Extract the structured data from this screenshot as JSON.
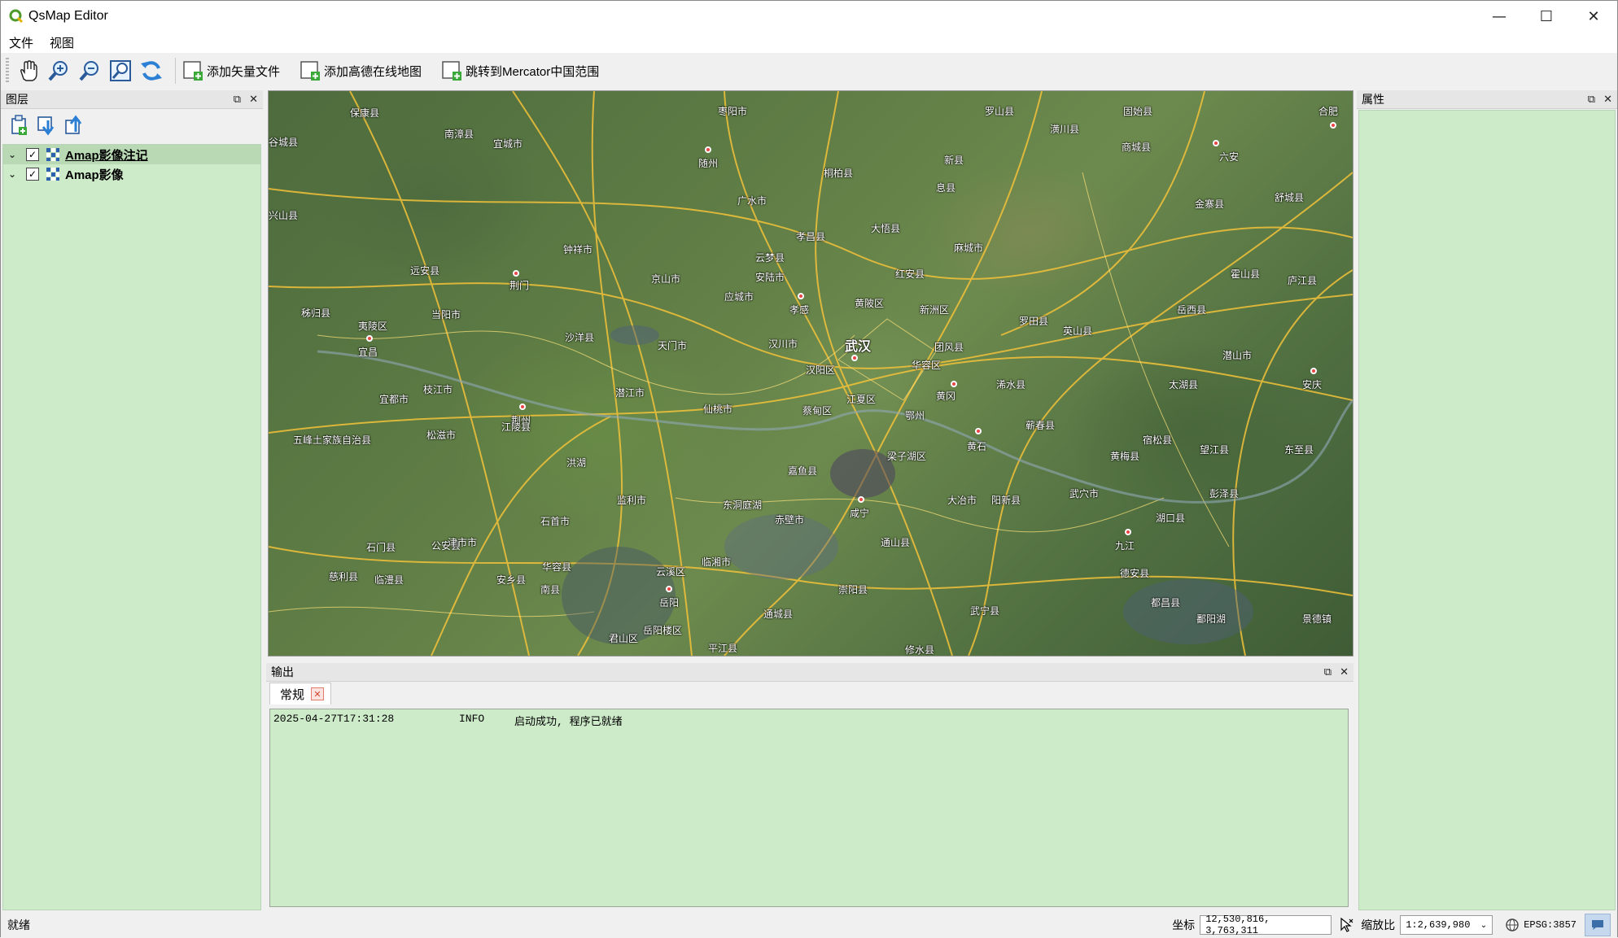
{
  "window": {
    "title": "QsMap Editor",
    "minimize": "—",
    "maximize": "☐",
    "close": "✕"
  },
  "menu": {
    "items": [
      "文件",
      "视图"
    ]
  },
  "toolbar": {
    "tools": [
      "pan-icon",
      "zoom-in-icon",
      "zoom-out-icon",
      "zoom-full-icon",
      "refresh-icon"
    ],
    "add_vector_label": "添加矢量文件",
    "add_amap_label": "添加高德在线地图",
    "jump_mercator_label": "跳转到Mercator中国范围"
  },
  "layers_panel": {
    "title": "图层",
    "layers": [
      {
        "name": "Amap影像注记",
        "checked": true,
        "selected": true
      },
      {
        "name": "Amap影像",
        "checked": true,
        "selected": false
      }
    ]
  },
  "attributes_panel": {
    "title": "属性"
  },
  "output_panel": {
    "title": "输出",
    "tab_label": "常规",
    "log": [
      {
        "time": "2025-04-27T17:31:28",
        "level": "INFO",
        "message": "启动成功, 程序已就绪"
      }
    ]
  },
  "map": {
    "labels": {
      "wuhan": "武汉",
      "xiaogan": "孝感",
      "huanggang": "黄冈",
      "huangshi": "黄石",
      "jingzhou": "荆州",
      "jingmen": "荆门",
      "yichang": "宜昌",
      "xianning": "咸宁",
      "yueyang": "岳阳",
      "jiujiang": "九江",
      "anqing": "安庆",
      "luan": "六安",
      "hefei": "合肥",
      "suizhou": "随州",
      "xinxian": "新县",
      "macheng": "麻城市",
      "tianmen": "天门市",
      "qianjiang": "潜江市",
      "xiantao": "仙桃市",
      "honghu": "洪湖",
      "jianli": "监利市",
      "shishou": "石首市",
      "gongan": "公安县",
      "songzi": "松滋市",
      "zhijiang": "枝江市",
      "dangyang": "当阳市",
      "yidu": "宜都市",
      "wufeng": "五峰土家族自治县",
      "yuanan": "远安县",
      "nanzhang": "南漳县",
      "baokang": "保康县",
      "xiangyang": "襄阳",
      "yicheng": "宜城市",
      "zhongxiang": "钟祥市",
      "shayang": "沙洋县",
      "jingshan": "京山市",
      "yingcheng": "应城市",
      "anlu": "安陆市",
      "guangshui": "广水市",
      "dawu": "大悟县",
      "hongan": "红安县",
      "huangpi": "黄陂区",
      "xinzhou": "新洲区",
      "tuanfeng": "团风县",
      "luotian": "罗田县",
      "yingshan": "英山县",
      "xishui": "浠水县",
      "qichun": "蕲春县",
      "wuxue": "武穴市",
      "huangmei": "黄梅县",
      "yangxin": "阳新县",
      "daye": "大冶市",
      "ezhou": "鄂州",
      "jiayu": "嘉鱼县",
      "chibi": "赤壁市",
      "chongyang": "崇阳县",
      "tongcheng": "通城县",
      "tongshan": "通山县",
      "linxiang": "临湘市",
      "huarong": "华容县",
      "nanxian": "南县",
      "anxiang": "安乡县",
      "linli": "临澧县",
      "cili": "慈利县",
      "shimen": "石门县",
      "jinzhou": "津市市",
      "hanyang": "汉阳区",
      "caidian": "蔡甸区",
      "jiangxia": "江夏区",
      "hanchuan": "汉川市",
      "huarongqu": "华容区",
      "xiaochang": "孝昌县",
      "yunmeng": "云梦县",
      "taihu": "太湖县",
      "susong": "宿松县",
      "wangjiang": "望江县",
      "dongzhi": "东至县",
      "pengze": "彭泽县",
      "hukou": "湖口县",
      "duchang": "都昌县",
      "dean": "德安县",
      "wuning": "武宁县",
      "xiushui": "修水县",
      "jingdezhen": "景德镇",
      "huoshan": "霍山县",
      "yuexi": "岳西县",
      "qianshan": "潜山市",
      "shucheng": "舒城县",
      "lujiang": "庐江县",
      "jinzhai": "金寨县",
      "shangcheng": "商城县",
      "gushi": "固始县",
      "huangchuan": "潢川县",
      "luoshan": "罗山县",
      "xixian": "息县",
      "tongbai": "桐柏县",
      "zaoyang": "枣阳市",
      "gucheng": "谷城县",
      "xingshan": "兴山县",
      "zigui": "秭归县",
      "yiling": "夷陵区",
      "yuanan2": "远安县",
      "jiangling": "江陵县",
      "poyang": "鄱阳湖",
      "dongtinghu": "东洞庭湖",
      "yunxi": "云溪区",
      "yueyanglou": "岳阳楼区",
      "junshan": "君山区",
      "pingjiang": "平江县",
      "xiushui2": "修水县",
      "liangzihu": "梁子湖区"
    }
  },
  "statusbar": {
    "message": "就绪",
    "coord_label": "坐标",
    "coord_value": "12,530,816, 3,763,311",
    "scale_label": "缩放比",
    "scale_value": "1:2,639,980",
    "crs": "EPSG:3857"
  }
}
